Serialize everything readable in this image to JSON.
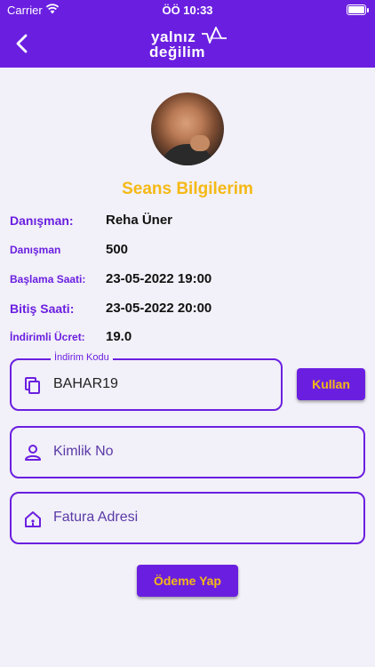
{
  "status_bar": {
    "carrier": "Carrier",
    "time": "ÖÖ 10:33"
  },
  "header": {
    "logo_line1": "yalnız",
    "logo_line2": "değilim"
  },
  "profile": {
    "section_title": "Seans Bilgilerim"
  },
  "details": [
    {
      "label": "Danışman:",
      "value": "Reha Üner"
    },
    {
      "label": "Danışman",
      "value": "500"
    },
    {
      "label": "Başlama Saati:",
      "value": "23-05-2022 19:00"
    },
    {
      "label": "Bitiş Saati:",
      "value": "23-05-2022 20:00"
    },
    {
      "label": "İndirimli Ücret:",
      "value": "19.0"
    }
  ],
  "discount": {
    "legend": "İndirim Kodu",
    "value": "BAHAR19",
    "apply_label": "Kullan"
  },
  "identity": {
    "placeholder": "Kimlik No"
  },
  "address": {
    "placeholder": "Fatura Adresi"
  },
  "payment": {
    "label": "Ödeme Yap"
  },
  "colors": {
    "primary": "#6a1fe0",
    "accent": "#f5b915",
    "background": "#f2f0f8"
  }
}
